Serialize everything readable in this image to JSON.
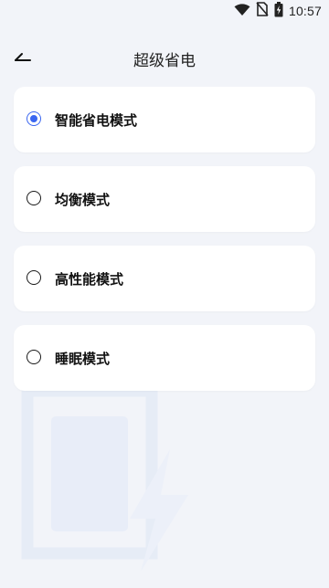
{
  "status_bar": {
    "time": "10:57",
    "icons": [
      "wifi-icon",
      "no-sim-icon",
      "battery-charging-icon"
    ]
  },
  "header": {
    "back_icon": "back-arrow-icon",
    "title": "超级省电"
  },
  "modes": [
    {
      "label": "智能省电模式",
      "selected": true
    },
    {
      "label": "均衡模式",
      "selected": false
    },
    {
      "label": "高性能模式",
      "selected": false
    },
    {
      "label": "睡眠模式",
      "selected": false
    }
  ],
  "colors": {
    "background": "#f2f4f9",
    "card": "#ffffff",
    "accent": "#3a66f0",
    "illustration": "#e6ecf8"
  }
}
